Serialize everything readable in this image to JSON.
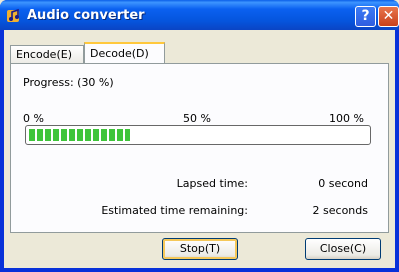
{
  "window": {
    "title": "Audio converter",
    "help_label": "?",
    "close_label": "✕"
  },
  "tabs": [
    {
      "label": "Encode(E)",
      "selected": false
    },
    {
      "label": "Decode(D)",
      "selected": true
    }
  ],
  "progress": {
    "label": "Progress: (30 %)",
    "value": 0.3,
    "ticks": [
      "0 %",
      "50 %",
      "100 %"
    ]
  },
  "stats": [
    {
      "label": "Lapsed time:",
      "value": "0 second"
    },
    {
      "label": "Estimated time remaining:",
      "value": "2 seconds"
    }
  ],
  "buttons": {
    "stop": "Stop(T)",
    "close": "Close(C)"
  },
  "colors": {
    "titlebar": "#0B61F0",
    "progress_fill": "#3FC43A",
    "selected_tab_accent": "#FFC83C"
  },
  "icons": {
    "app": "music-note-icon"
  }
}
